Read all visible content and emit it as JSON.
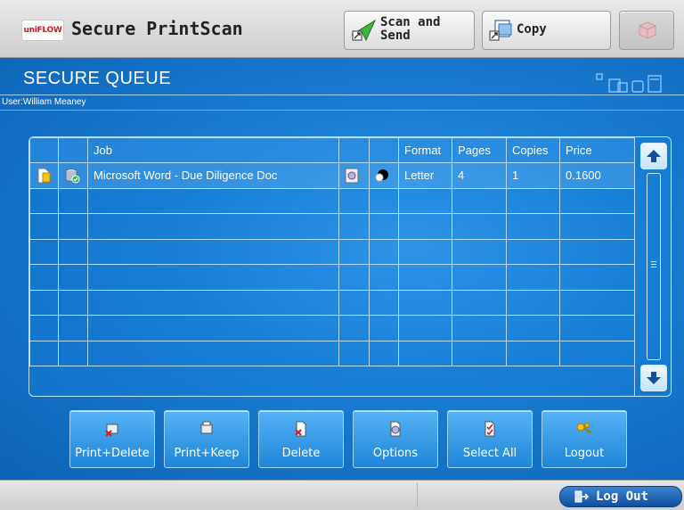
{
  "app": {
    "logo_text": "uniFLOW",
    "title": "Secure PrintScan"
  },
  "top_buttons": {
    "scan_line1": "Scan and",
    "scan_line2": "Send",
    "copy": "Copy"
  },
  "screen": {
    "title": "SECURE QUEUE",
    "user": "User:William Meaney"
  },
  "table": {
    "headers": [
      "",
      "",
      "Job",
      "",
      "",
      "Format",
      "Pages",
      "Copies",
      "Price"
    ],
    "rows": [
      {
        "job": "Microsoft Word - Due Diligence Doc",
        "format": "Letter",
        "pages": "4",
        "copies": "1",
        "price": "0.1600"
      }
    ]
  },
  "actions": {
    "print_delete": "Print+Delete",
    "print_keep": "Print+Keep",
    "delete": "Delete",
    "options": "Options",
    "select_all": "Select All",
    "logout": "Logout"
  },
  "status": {
    "logout_pill": "Log Out"
  },
  "icons": {
    "document": "document-icon",
    "database": "database-check-icon",
    "print_settings": "print-settings-icon",
    "color_mode": "color-mode-icon"
  },
  "colors": {
    "accent_blue": "#1a7ed3",
    "logout_pill": "#0f4f9c"
  }
}
